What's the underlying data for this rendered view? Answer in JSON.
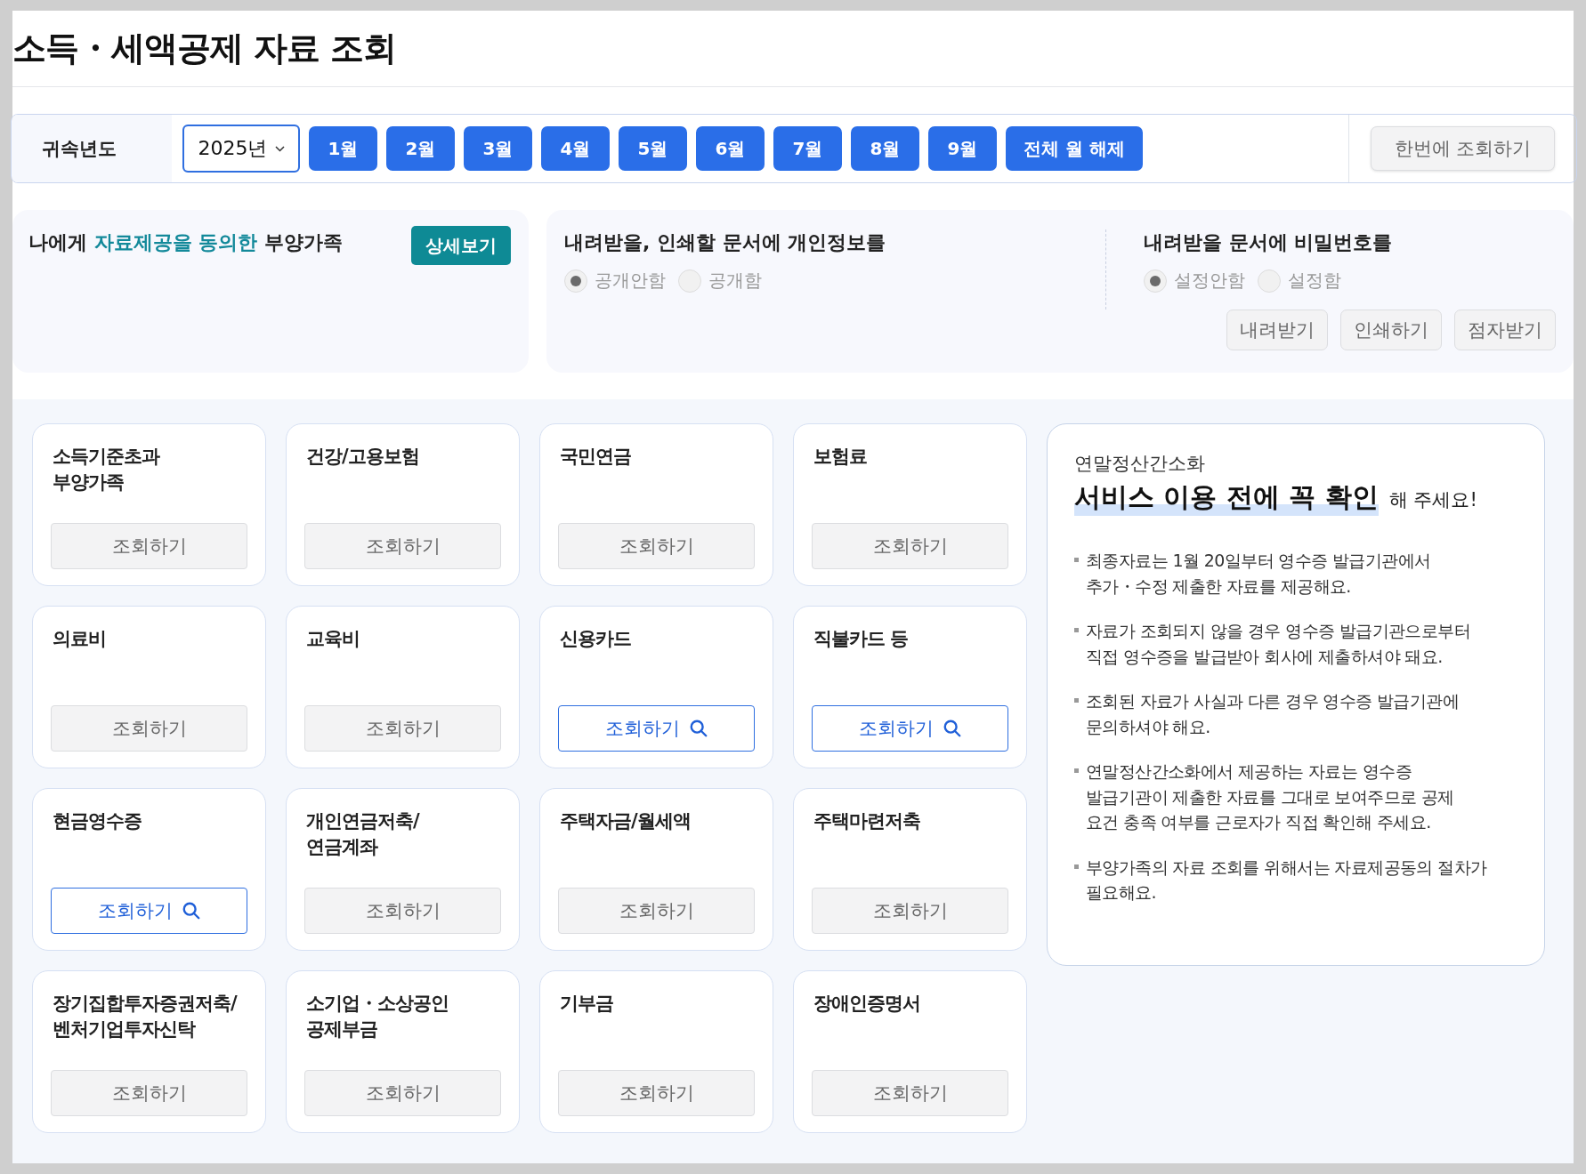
{
  "page_title": "소득・세액공제 자료 조회",
  "filter_bar": {
    "label": "귀속년도",
    "year": "2025년",
    "months": [
      "1월",
      "2월",
      "3월",
      "4월",
      "5월",
      "6월",
      "7월",
      "8월",
      "9월"
    ],
    "clear_button": "전체 월 해제",
    "lookup_all_button": "한번에 조회하기"
  },
  "consent_panel": {
    "title": [
      {
        "text": "나에게 ",
        "highlight": false
      },
      {
        "text": "자료제공을 동의한",
        "highlight": true
      },
      {
        "text": " 부양가족",
        "highlight": false
      }
    ],
    "detail_button": "상세보기"
  },
  "document_options": [
    {
      "title": "내려받을, 인쇄할 문서에 개인정보를",
      "options": [
        {
          "label": "공개안함",
          "selected": true
        },
        {
          "label": "공개함",
          "selected": false
        }
      ]
    },
    {
      "title": "내려받을 문서에 비밀번호를",
      "options": [
        {
          "label": "설정안함",
          "selected": true
        },
        {
          "label": "설정함",
          "selected": false
        }
      ]
    }
  ],
  "document_buttons": [
    "내려받기",
    "인쇄하기",
    "점자받기"
  ],
  "categories": [
    {
      "title": "소득기준초과\n부양가족",
      "button": "조회하기",
      "active": false
    },
    {
      "title": "건강/고용보험",
      "button": "조회하기",
      "active": false
    },
    {
      "title": "국민연금",
      "button": "조회하기",
      "active": false
    },
    {
      "title": "보험료",
      "button": "조회하기",
      "active": false
    },
    {
      "title": "의료비",
      "button": "조회하기",
      "active": false
    },
    {
      "title": "교육비",
      "button": "조회하기",
      "active": false
    },
    {
      "title": "신용카드",
      "button": "조회하기",
      "active": true
    },
    {
      "title": "직불카드 등",
      "button": "조회하기",
      "active": true
    },
    {
      "title": "현금영수증",
      "button": "조회하기",
      "active": true
    },
    {
      "title": "개인연금저축/\n연금계좌",
      "button": "조회하기",
      "active": false
    },
    {
      "title": "주택자금/월세액",
      "button": "조회하기",
      "active": false
    },
    {
      "title": "주택마련저축",
      "button": "조회하기",
      "active": false
    },
    {
      "title": "장기집합투자증권저축/\n벤처기업투자신탁",
      "button": "조회하기",
      "active": false
    },
    {
      "title": "소기업・소상공인\n공제부금",
      "button": "조회하기",
      "active": false
    },
    {
      "title": "기부금",
      "button": "조회하기",
      "active": false
    },
    {
      "title": "장애인증명서",
      "button": "조회하기",
      "active": false
    }
  ],
  "notice": {
    "eyebrow": "연말정산간소화",
    "headline_highlight": "서비스 이용 전에 꼭 확인",
    "headline_rest": "해 주세요!",
    "items": [
      "최종자료는 1월 20일부터 영수증 발급기관에서\n추가・수정 제출한 자료를 제공해요.",
      "자료가 조회되지 않을 경우 영수증 발급기관으로부터\n직접 영수증을 발급받아 회사에 제출하셔야 돼요.",
      "조회된 자료가 사실과 다른 경우 영수증 발급기관에\n문의하셔야 해요.",
      "연말정산간소화에서 제공하는 자료는 영수증\n발급기관이 제출한 자료를 그대로 보여주므로 공제\n요건 충족 여부를 근로자가 직접 확인해 주세요.",
      "부양가족의 자료 조회를 위해서는 자료제공동의 절차가\n필요해요."
    ]
  }
}
